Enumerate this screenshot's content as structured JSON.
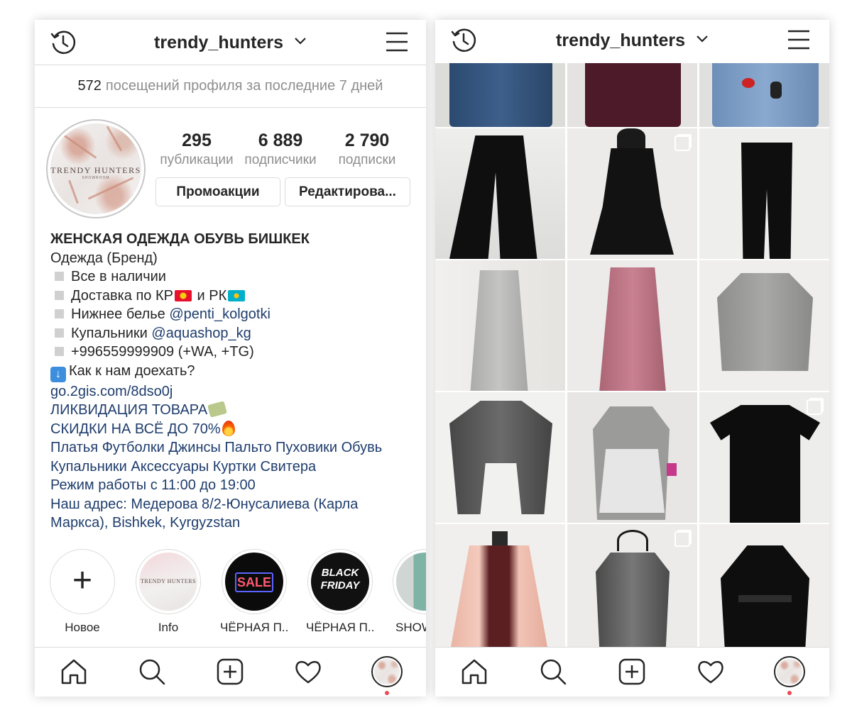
{
  "profile": {
    "username": "trendy_hunters",
    "visits_count": "572",
    "visits_text": "посещений профиля за последние 7 дней",
    "stats": [
      {
        "value": "295",
        "label": "публикации"
      },
      {
        "value": "6 889",
        "label": "подписчики"
      },
      {
        "value": "2 790",
        "label": "подписки"
      }
    ],
    "buttons": {
      "promo": "Промоакции",
      "edit": "Редактирова..."
    },
    "avatar_text": "TRENDY HUNTERS",
    "avatar_subtext": "SHOWROOM"
  },
  "bio": {
    "name": "ЖЕНСКАЯ ОДЕЖДА ОБУВЬ БИШКЕК",
    "category": "Одежда (Бренд)",
    "line1": "Все в наличии",
    "line2_a": "Доставка по КР",
    "line2_b": " и РК",
    "line3_text": "Нижнее белье ",
    "line3_link": "@penti_kolgotki",
    "line4_text": "Купальники ",
    "line4_link": "@aquashop_kg",
    "line5": "+996559999909 (+WA, +TG)",
    "line6": "Как к нам доехать?",
    "link": "go.2gis.com/8dso0j",
    "liquidation": "ЛИКВИДАЦИЯ ТОВАРА",
    "discount": "СКИДКИ НА ВСЁ ДО 70%",
    "tags1": "Платья Футболки Джинсы Пальто Пуховики Обувь",
    "tags2": "Купальники Аксессуары Куртки Свитера",
    "hours": "Режим работы с 11:00 до 19:00",
    "address1": "Наш адрес: Медерова 8/2-Юнусалиева (Карла",
    "address2": "Маркса), Bishkek, Kyrgyzstan"
  },
  "highlights": [
    {
      "label": "Новое",
      "icon": "plus-icon"
    },
    {
      "label": "Info",
      "cover_text": "TRENDY HUNTERS"
    },
    {
      "label": "ЧЁРНАЯ П...",
      "cover_text": "SALE"
    },
    {
      "label": "ЧЁРНАЯ П...",
      "cover_text": "BLACK FRIDAY"
    },
    {
      "label": "SHOW"
    }
  ],
  "nav": {
    "icons": [
      "home-icon",
      "search-icon",
      "new-post-icon",
      "activity-heart-icon",
      "profile-avatar"
    ]
  },
  "colors": {
    "link_blue": "#1f3d6d",
    "secondary_gray": "#8e8e8e",
    "border": "#dbdbdb",
    "notification_red": "#ed4956"
  }
}
